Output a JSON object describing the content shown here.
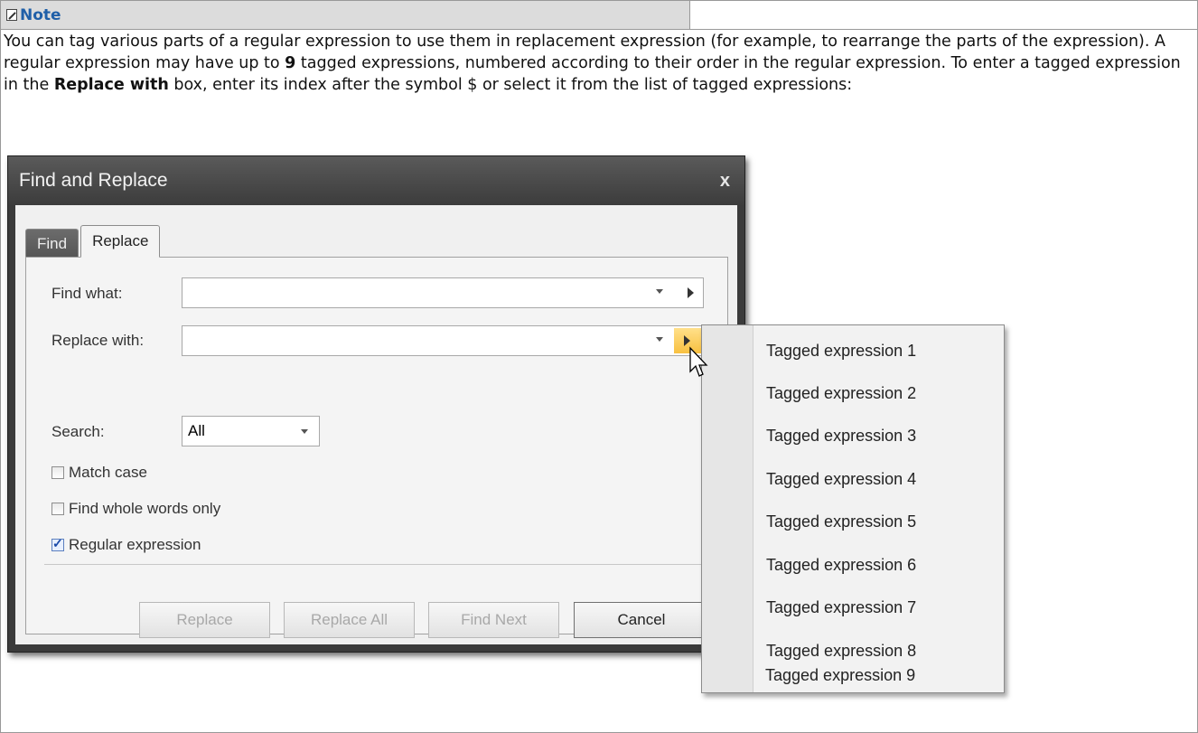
{
  "note": {
    "title": "Note",
    "paragraph": {
      "p1": "You can tag various parts of a regular expression to use them in replacement expression (for example, to rearrange the parts of the expression). A regular expression may have up to ",
      "bold1": "9",
      "p2": " tagged expressions, numbered according to their order in the regular expression. To enter a tagged expression in the ",
      "bold2": "Replace with",
      "p3": " box, enter its index after the symbol $ or select it from the list of tagged expressions:"
    }
  },
  "dialog": {
    "title": "Find and Replace",
    "close": "x",
    "tabs": [
      "Find",
      "Replace"
    ],
    "find_what_label": "Find what:",
    "find_what_value": "",
    "replace_with_label": "Replace with:",
    "replace_with_value": "",
    "search_label": "Search:",
    "search_value": "All",
    "checkboxes": [
      {
        "label": "Match case",
        "checked": false
      },
      {
        "label": "Find whole words only",
        "checked": false
      },
      {
        "label": "Regular expression",
        "checked": true
      }
    ],
    "buttons": {
      "replace": "Replace",
      "replace_all": "Replace All",
      "find_next": "Find Next",
      "cancel": "Cancel"
    }
  },
  "popup_menu": {
    "items": [
      "Tagged expression 1",
      "Tagged expression 2",
      "Tagged expression 3",
      "Tagged expression 4",
      "Tagged expression 5",
      "Tagged expression 6",
      "Tagged expression 7",
      "Tagged expression 8",
      "Tagged expression 9"
    ]
  },
  "colors": {
    "note_title": "#1f5fa8",
    "header_bg": "#dcdcdc",
    "hot_arrow": "#f8c040"
  },
  "icons": [
    "note-icon",
    "close-icon",
    "dropdown-arrow-icon",
    "submenu-arrow-icon",
    "check-icon",
    "mouse-pointer-icon"
  ]
}
